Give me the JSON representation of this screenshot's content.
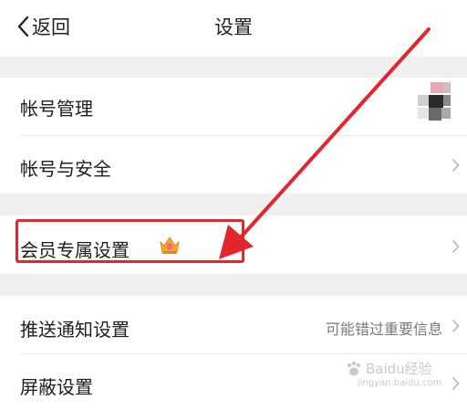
{
  "header": {
    "back_label": "返回",
    "title": "设置"
  },
  "sections": [
    {
      "label": "帐号管理"
    },
    {
      "label": "帐号与安全"
    },
    {
      "label": "会员专属设置"
    },
    {
      "label": "推送通知设置",
      "value": "可能错过重要信息"
    },
    {
      "label": "屏蔽设置"
    }
  ],
  "watermark": {
    "brand": "Baidu经验",
    "url": "jingyan.baidu.com"
  },
  "colors": {
    "highlight": "#e3262e",
    "divider_bg": "#f0f0f0",
    "crown": "#f3a33b"
  },
  "icons": {
    "back": "chevron-left-icon",
    "row_arrow": "chevron-right-icon",
    "member": "crown-icon"
  }
}
